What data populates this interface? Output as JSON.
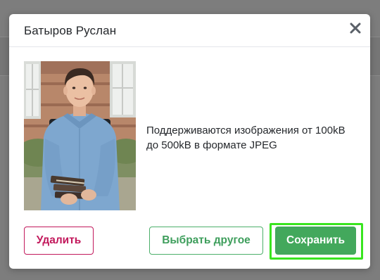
{
  "modal": {
    "title": "Батыров Руслан",
    "hint": "Поддерживаются изображения от 100kB до 500kB в формате JPEG",
    "buttons": {
      "delete": "Удалить",
      "choose_other": "Выбрать другое",
      "save": "Сохранить"
    },
    "icons": {
      "close": "close-icon"
    }
  },
  "colors": {
    "delete": "#c2185b",
    "choose_border": "#4caf6a",
    "save_bg": "#43a85c",
    "focus_outline": "#39e51f"
  }
}
